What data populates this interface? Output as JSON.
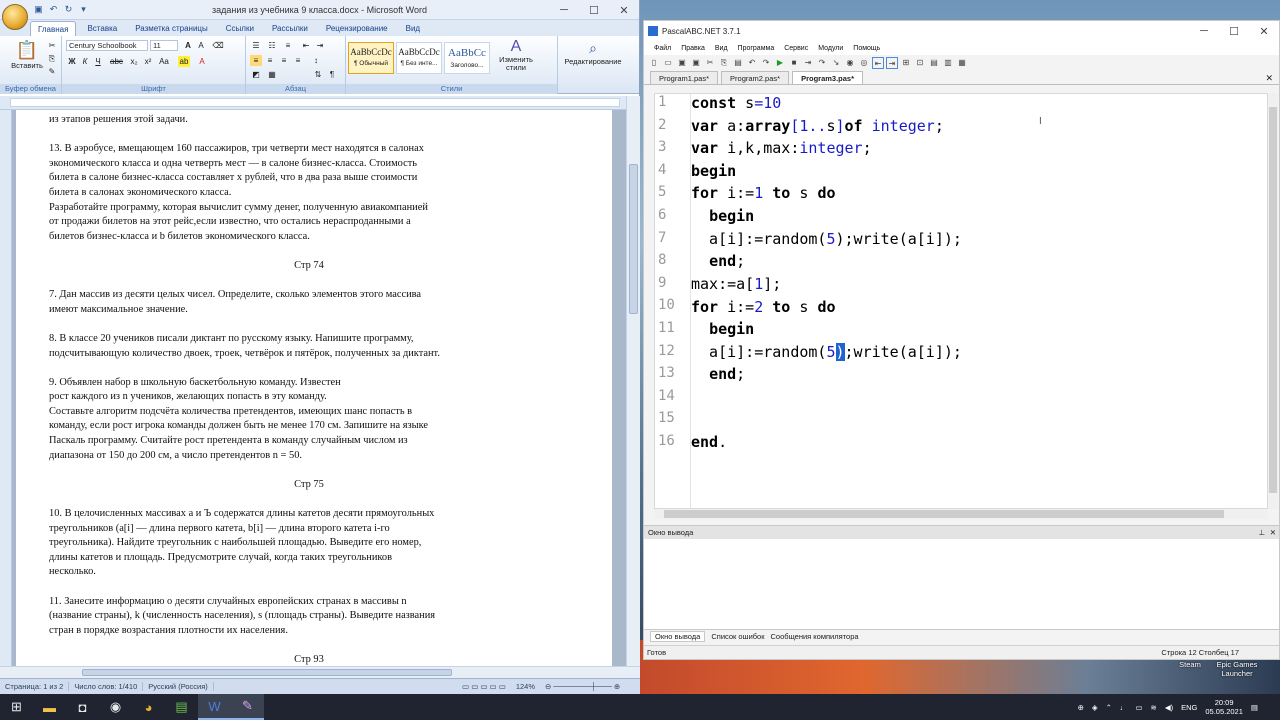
{
  "word": {
    "title": "задания из учебника 9 класса.docx - Microsoft Word",
    "tabs": [
      "Главная",
      "Вставка",
      "Разметка страницы",
      "Ссылки",
      "Рассылки",
      "Рецензирование",
      "Вид"
    ],
    "font_name": "Century Schoolbook",
    "font_size": "11",
    "paste_label": "Вставить",
    "styles": [
      {
        "preview": "AaBbCcDc",
        "name": "¶ Обычный"
      },
      {
        "preview": "AaBbCcDc",
        "name": "¶ Без инте..."
      },
      {
        "preview": "AaBbCc",
        "name": "Заголово..."
      }
    ],
    "change_styles": "Изменить стили",
    "editing": "Редактирование",
    "groups": [
      "Буфер обмена",
      "Шрифт",
      "Абзац",
      "Стили"
    ],
    "lines": [
      "из этапов решения этой задачи.",
      "",
      "13. В аэробусе, вмещающем 160 пассажиров, три четверти мест находятся в салонах",
      "экономического класса и одна четверть мест — в салоне бизнес-класса. Стоимость",
      "билета в салоне бизнес-класса составляет x рублей, что в два раза выше стоимости",
      "билета в салонах экономического класса.",
      "Разработайте программу, которая вычислит сумму денег, полученную авиакомпанией",
      "от продажи билетов на этот рейс,если известно, что остались нераспроданными a",
      "билетов бизнес-класса и b билетов экономического класса.",
      "",
      "Стр 74",
      "",
      "7. Дан массив из десяти целых чисел. Определите, сколько элементов этого массива",
      "имеют максимальное значение.",
      "",
      "8. В классе 20 учеников писали диктант по русскому языку. Напишите программу,",
      "подсчитывающую количество двоек, троек, четвёрок и пятёрок, полученных за диктант.",
      "",
      "9. Объявлен набор в школьную баскетбольную команду. Известен",
      "рост каждого из n учеников, желающих попасть в эту команду.",
      "Составьте алгоритм подсчёта количества претендентов, имеющих шанс попасть в",
      "команду, если рост игрока команды должен быть не менее 170 см. Запишите на языке",
      "Паскаль программу. Считайте рост претендента в команду случайным числом из",
      "диапазона от 150 до 200 см, а число претендентов n = 50.",
      "",
      "Стр 75",
      "",
      "10. В целочисленных массивах a и Ъ содержатся длины катетов десяти прямоугольных",
      "треугольников (a[i] — длина первого катета, b[i] — длина второго катета i-го",
      "треугольника). Найдите треугольник с наибольшей площадью. Выведите его номер,",
      "длины катетов и площадь. Предусмотрите случай, когда таких треугольников",
      "несколько.",
      "",
      "11. Занесите информацию о десяти случайных европейских странах в массивы n",
      "(название страны), k (численность населения), s (площадь страны). Выведите названия",
      "стран в порядке возрастания плотности их населения.",
      "",
      "Стр 93"
    ],
    "status": {
      "page": "Страница: 1 из 2",
      "words": "Число слов: 1/410",
      "lang": "Русский (Россия)",
      "zoom": "124%"
    }
  },
  "pascal": {
    "title": "PascalABC.NET 3.7.1",
    "menu": [
      "Файл",
      "Правка",
      "Вид",
      "Программа",
      "Сервис",
      "Модули",
      "Помощь"
    ],
    "tabs": [
      "Program1.pas*",
      "Program2.pas*",
      "Program3.pas*"
    ],
    "line_numbers": [
      "1",
      "2",
      "3",
      "4",
      "5",
      "6",
      "7",
      "8",
      "9",
      "10",
      "11",
      "12",
      "13",
      "14",
      "15",
      "16"
    ],
    "output_title": "Окно вывода",
    "output_tabs": [
      "Окно вывода",
      "Список ошибок",
      "Сообщения компилятора"
    ],
    "status_left": "Готов",
    "status_right": "Строка  12  Столбец  17"
  },
  "desktop": {
    "steam": "Steam",
    "epic": "Epic Games Launcher"
  },
  "tray": {
    "lang": "ENG",
    "time": "20:09",
    "date": "05.05.2021"
  },
  "colors": {
    "keyword": "#000000",
    "type": "#1a1ac8",
    "word_blue": "#15428b"
  }
}
